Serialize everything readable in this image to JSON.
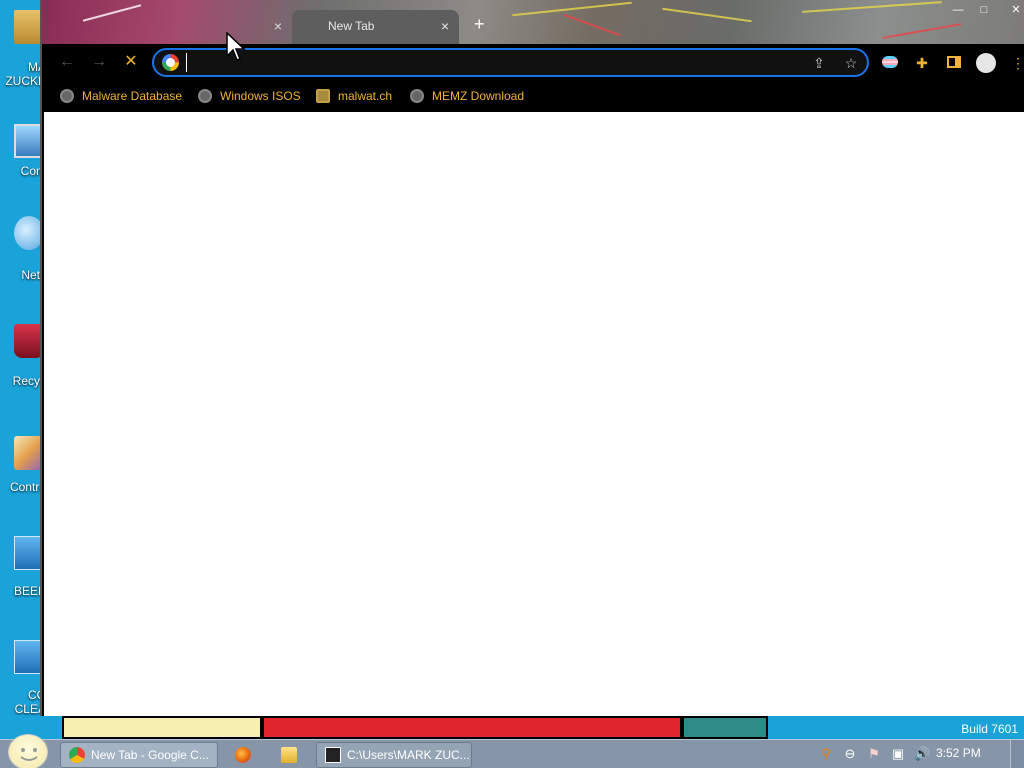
{
  "desktop_icons": [
    {
      "label_line1": "MA",
      "label_line2": "ZUCKE",
      "icon": "user-folder-icon"
    },
    {
      "label_line1": "Com",
      "icon": "computer-icon"
    },
    {
      "label_line1": "Netv",
      "icon": "network-icon"
    },
    {
      "label_line1": "Recyc",
      "icon": "recycle-bin-icon"
    },
    {
      "label_line1": "Contro",
      "icon": "control-panel-icon"
    },
    {
      "label_line1": "BEEP",
      "icon": "shortcut-icon"
    },
    {
      "label_line1": "CO",
      "label_line2": "CLEA",
      "icon": "shortcut-icon"
    }
  ],
  "browser": {
    "tabs": [
      {
        "title": "",
        "close": "×",
        "active": false
      },
      {
        "title": "New Tab",
        "close": "×",
        "active": true
      }
    ],
    "new_tab": "+",
    "window_controls": {
      "minimize": "—",
      "maximize": "□",
      "close": "✕"
    },
    "nav": {
      "back": "←",
      "forward": "→",
      "stop": "✕"
    },
    "omnibox": {
      "value": "",
      "placeholder": ""
    },
    "bookmarks": [
      {
        "label": "Malware Database"
      },
      {
        "label": "Windows ISOS"
      },
      {
        "label": "malwat.ch"
      },
      {
        "label": "MEMZ Download"
      }
    ]
  },
  "taskbar": {
    "items": [
      {
        "label": "New Tab - Google C...",
        "icon": "chrome-icon"
      },
      {
        "label": "",
        "icon": "firefox-icon"
      },
      {
        "label": "",
        "icon": "folder-icon"
      },
      {
        "label": "C:\\Users\\MARK ZUC...",
        "icon": "7zip-icon"
      }
    ],
    "clock": "3:52 PM",
    "build": "Build 7601"
  },
  "colors": {
    "accent": "#1a73e8",
    "bookmark_text": "#f2b233",
    "desktop": "#1aa3d9",
    "taskbar": "#8696a8"
  }
}
